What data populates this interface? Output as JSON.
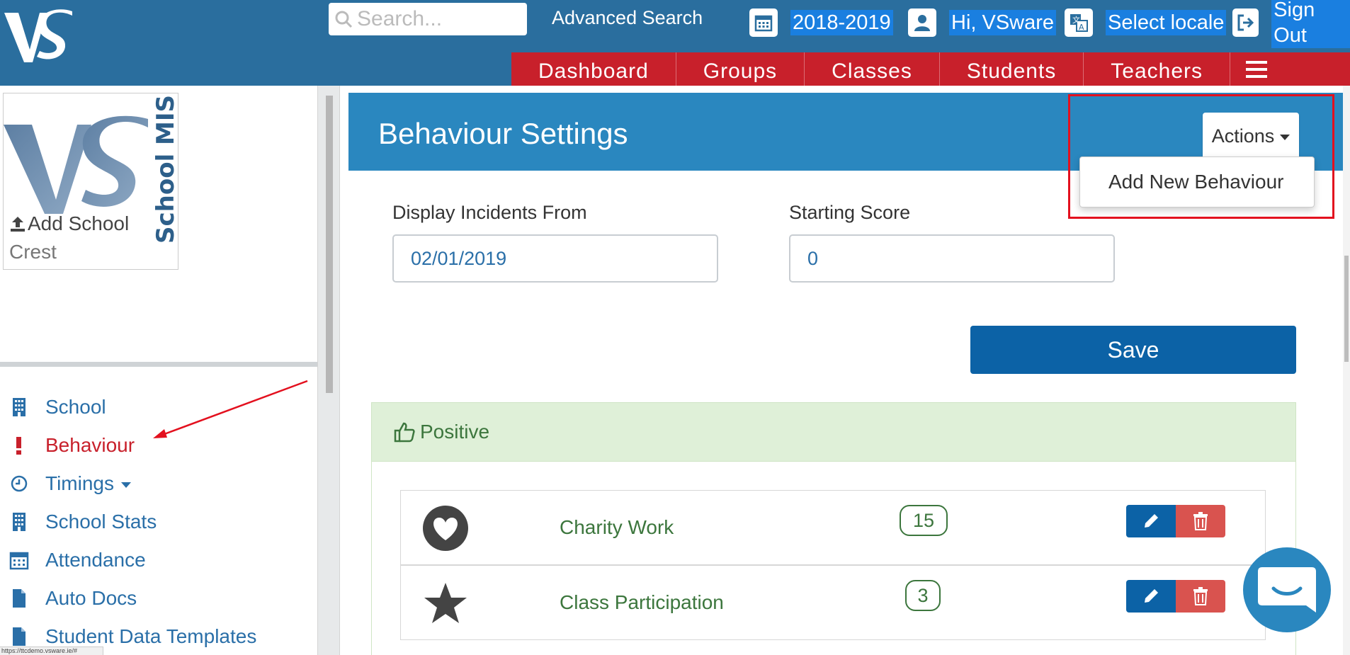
{
  "topbar": {
    "search_placeholder": "Search...",
    "advanced_search": "Advanced Search",
    "year": "2018-2019",
    "greeting": "Hi, VSware",
    "locale": "Select locale",
    "sign_out": "Sign Out"
  },
  "nav": {
    "items": [
      "Dashboard",
      "Groups",
      "Classes",
      "Students",
      "Teachers"
    ]
  },
  "left": {
    "crest_logo_text": "School MIS",
    "crest_line1": "Add School",
    "crest_line2": "Crest",
    "menu": [
      {
        "label": "School",
        "icon": "building-icon"
      },
      {
        "label": "Behaviour",
        "icon": "exclamation-icon"
      },
      {
        "label": "Timings",
        "icon": "clock-icon"
      },
      {
        "label": "School Stats",
        "icon": "building-icon"
      },
      {
        "label": "Attendance",
        "icon": "calendar-icon"
      },
      {
        "label": "Auto Docs",
        "icon": "document-icon"
      },
      {
        "label": "Student Data Templates",
        "icon": "document-icon"
      }
    ]
  },
  "main": {
    "title": "Behaviour Settings",
    "actions_label": "Actions",
    "dropdown_item": "Add New Behaviour",
    "display_from_label": "Display Incidents From",
    "display_from_value": "02/01/2019",
    "starting_score_label": "Starting Score",
    "starting_score_value": "0",
    "save_label": "Save",
    "positive_label": "Positive",
    "rows": [
      {
        "name": "Charity Work",
        "score": "15",
        "icon": "heart-icon"
      },
      {
        "name": "Class Participation",
        "score": "3",
        "icon": "star-icon"
      }
    ]
  },
  "status_url": "https://ttcdemo.vsware.ie/#",
  "colors": {
    "topbar": "#2a6e9e",
    "nav": "#c8202b",
    "header": "#2a87bf",
    "save": "#0c62a6",
    "positive_text": "#3c763d",
    "active_menu": "#c8202b"
  }
}
